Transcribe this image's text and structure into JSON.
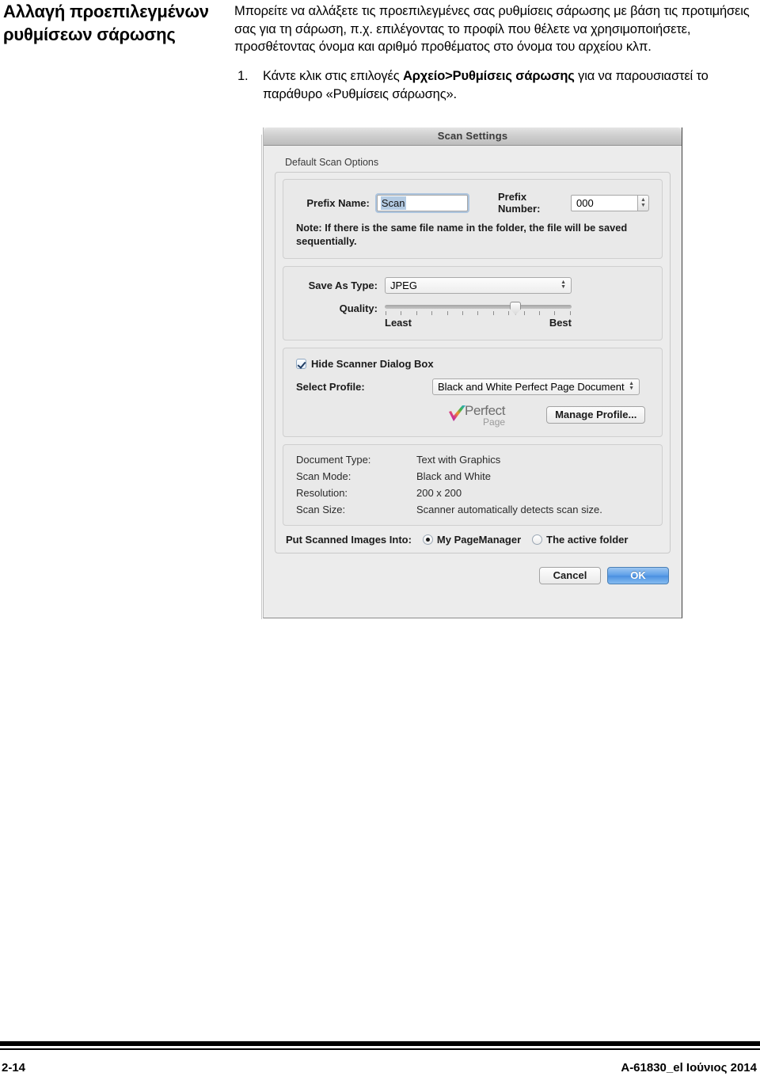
{
  "page": {
    "heading": "Αλλαγή προεπιλεγμένων ρυθμίσεων σάρωσης",
    "intro": "Μπορείτε να αλλάξετε τις προεπιλεγμένες σας ρυθμίσεις σάρωσης με βάση τις προτιμήσεις σας για τη σάρωση, π.χ. επιλέγοντας το προφίλ που θέλετε να χρησιμοποιήσετε, προσθέτοντας όνομα και αριθμό προθέματος στο όνομα του αρχείου κλπ.",
    "steps": [
      {
        "number": "1.",
        "part1": "Κάντε κλικ στις επιλογές ",
        "bold": "Αρχείο>Ρυθμίσεις σάρωσης",
        "part2": " για να παρουσιαστεί το παράθυρο «Ρυθμίσεις σάρωσης»."
      }
    ]
  },
  "footer": {
    "page_number": "2-14",
    "doc_id": "A-61830_el  Ιούνιος 2014"
  },
  "dialog": {
    "title": "Scan Settings",
    "group_label": "Default Scan Options",
    "prefix_name_label": "Prefix Name:",
    "prefix_name_value": "Scan",
    "prefix_number_label": "Prefix Number:",
    "prefix_number_value": "000",
    "note": "Note: If there is the same file name in the folder, the file will be saved sequentially.",
    "save_as_type_label": "Save As Type:",
    "save_as_type_value": "JPEG",
    "quality_label": "Quality:",
    "quality_least": "Least",
    "quality_best": "Best",
    "quality_position_pct": 70,
    "quality_tick_count": 13,
    "hide_dialog_label": "Hide Scanner Dialog Box",
    "hide_dialog_checked": true,
    "select_profile_label": "Select Profile:",
    "select_profile_value": "Black and White Perfect Page Document",
    "logo_primary": "Perfect",
    "logo_secondary": "Page",
    "manage_profile_label": "Manage Profile...",
    "summary": [
      {
        "key": "Document Type:",
        "value": "Text with Graphics"
      },
      {
        "key": "Scan Mode:",
        "value": "Black and White"
      },
      {
        "key": "Resolution:",
        "value": "200 x 200"
      },
      {
        "key": "Scan Size:",
        "value": "Scanner automatically detects scan size."
      }
    ],
    "put_images_label": "Put Scanned Images Into:",
    "radio_options": [
      {
        "label": "My PageManager",
        "selected": true
      },
      {
        "label": "The active folder",
        "selected": false
      }
    ],
    "cancel_label": "Cancel",
    "ok_label": "OK",
    "accent_color": "#5b9de8"
  }
}
